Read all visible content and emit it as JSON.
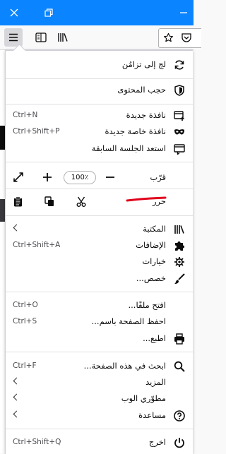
{
  "window": {
    "accent": "#0a84ff"
  },
  "menu": {
    "sync": {
      "label": "لج إلى تزامُن",
      "icon": "sync-icon"
    },
    "content_blocking": {
      "label": "حجب المحتوى",
      "icon": "shield-icon"
    },
    "new_window": {
      "label": "نافذة جديدة",
      "shortcut": "Ctrl+N"
    },
    "new_private_window": {
      "label": "نافذة خاصة جديدة",
      "shortcut": "Ctrl+Shift+P"
    },
    "restore_session": {
      "label": "استعد الجلسة السابقة"
    },
    "zoom": {
      "label": "قرّب",
      "value": "100٪"
    },
    "edit": {
      "label": "حرر"
    },
    "library": {
      "label": "المكتبة"
    },
    "addons": {
      "label": "الإضافات",
      "shortcut": "Ctrl+Shift+A"
    },
    "options": {
      "label": "خيارات"
    },
    "customize": {
      "label": "خصص..."
    },
    "open_file": {
      "label": "افتح ملفًا...",
      "shortcut": "Ctrl+O"
    },
    "save_page": {
      "label": "احفظ الصفحة باسم...",
      "shortcut": "Ctrl+S"
    },
    "print": {
      "label": "اطبع..."
    },
    "find": {
      "label": "ابحث في هذه الصفحة...",
      "shortcut": "Ctrl+F"
    },
    "more": {
      "label": "المزيد"
    },
    "web_developer": {
      "label": "مطوّري الوب"
    },
    "help": {
      "label": "مساعدة"
    },
    "quit": {
      "label": "اخرج",
      "shortcut": "Ctrl+Shift+Q"
    }
  },
  "annotation": {
    "color": "#e0001b"
  }
}
